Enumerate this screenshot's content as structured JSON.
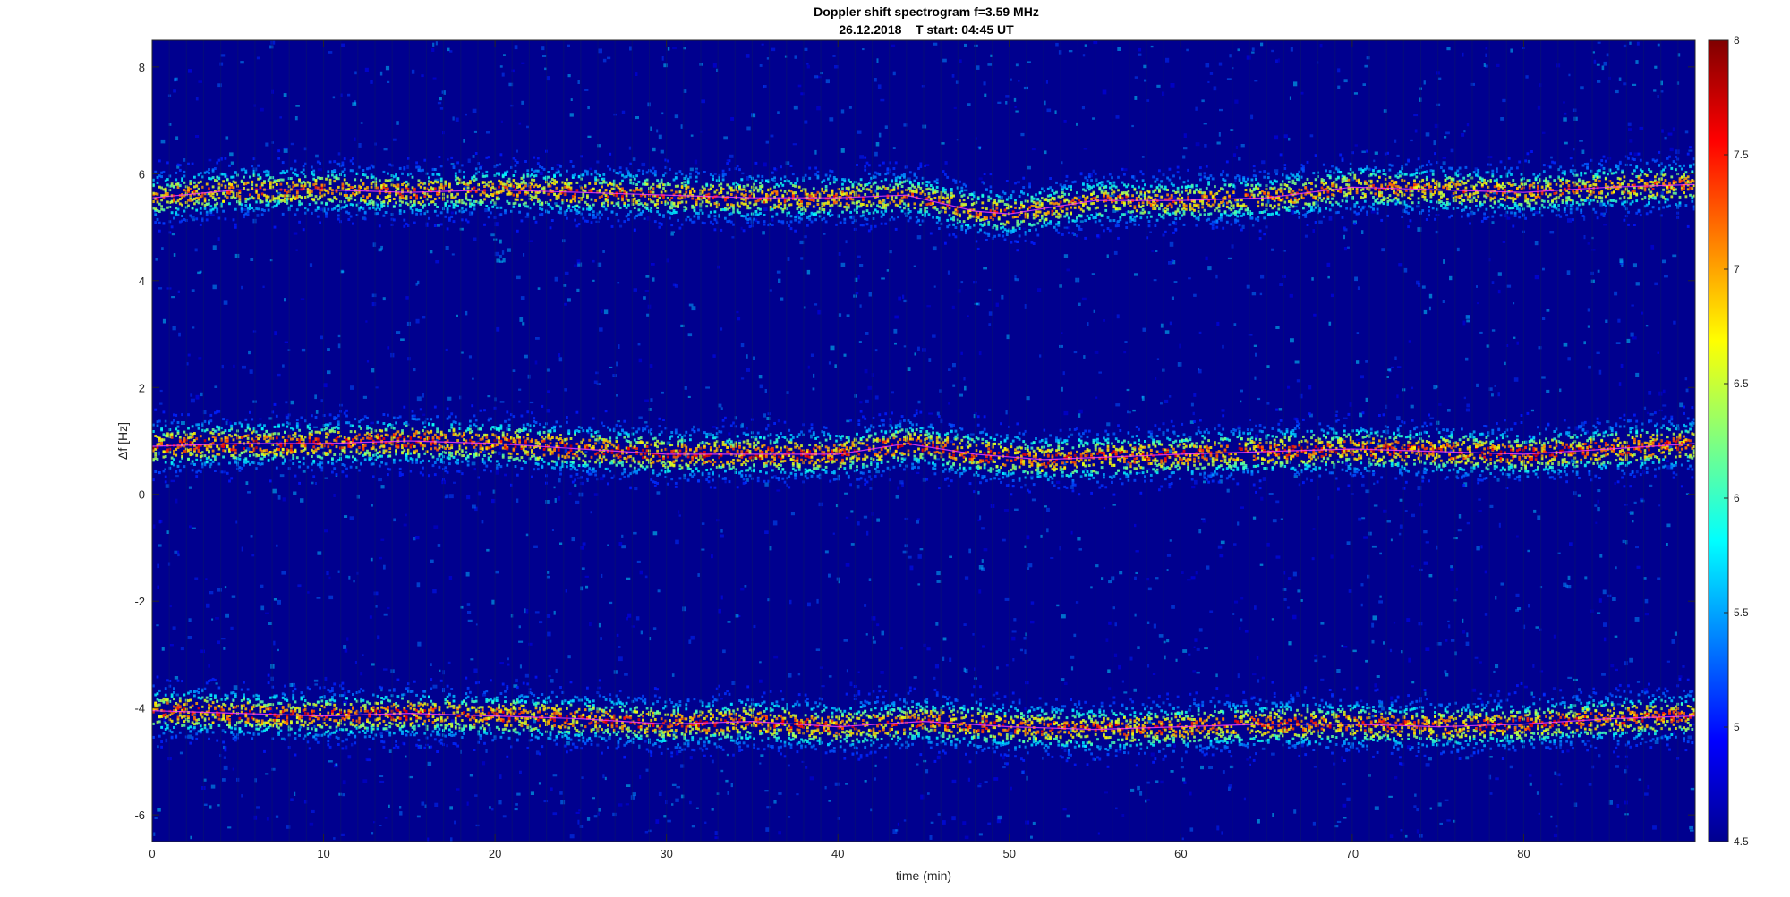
{
  "chart_data": {
    "type": "heatmap",
    "title": "Doppler shift spectrogram f=3.59 MHz",
    "subtitle": "26.12.2018    T start: 04:45 UT",
    "xlabel": "time (min)",
    "ylabel": "Δf [Hz]",
    "xlim": [
      0,
      90
    ],
    "ylim": [
      -6.5,
      8.5
    ],
    "x_ticks": [
      0,
      10,
      20,
      30,
      40,
      50,
      60,
      70,
      80
    ],
    "y_ticks": [
      -6,
      -4,
      -2,
      0,
      2,
      4,
      6,
      8
    ],
    "colormap": "jet",
    "clim": [
      4.5,
      8
    ],
    "colorbar_ticks": [
      4.5,
      5,
      5.5,
      6,
      6.5,
      7,
      7.5,
      8
    ],
    "colorbar_tick_labels": [
      "4.5",
      "5",
      "5.5",
      "6",
      "6.5",
      "7",
      "7.5",
      "8"
    ],
    "background_level": 4.8,
    "traces": [
      {
        "time": [
          0,
          5,
          10,
          15,
          20,
          25,
          30,
          35,
          40,
          44,
          48,
          50,
          55,
          60,
          65,
          70,
          75,
          80,
          85,
          90
        ],
        "doppler_hz": [
          5.55,
          5.7,
          5.7,
          5.65,
          5.7,
          5.65,
          5.6,
          5.55,
          5.55,
          5.6,
          5.3,
          5.25,
          5.5,
          5.5,
          5.55,
          5.75,
          5.7,
          5.65,
          5.75,
          5.8
        ],
        "peak_level": 7.6
      },
      {
        "time": [
          0,
          5,
          10,
          15,
          20,
          25,
          30,
          35,
          40,
          44,
          48,
          52,
          56,
          60,
          65,
          70,
          75,
          80,
          85,
          90
        ],
        "doppler_hz": [
          0.9,
          0.95,
          0.95,
          1.0,
          0.95,
          0.85,
          0.75,
          0.75,
          0.75,
          0.95,
          0.75,
          0.65,
          0.7,
          0.75,
          0.8,
          0.85,
          0.8,
          0.75,
          0.85,
          0.95
        ],
        "peak_level": 7.9
      },
      {
        "time": [
          0,
          5,
          10,
          15,
          20,
          25,
          30,
          35,
          40,
          45,
          50,
          55,
          60,
          65,
          70,
          75,
          80,
          85,
          90
        ],
        "doppler_hz": [
          -4.05,
          -4.1,
          -4.15,
          -4.1,
          -4.15,
          -4.2,
          -4.3,
          -4.25,
          -4.35,
          -4.25,
          -4.35,
          -4.4,
          -4.35,
          -4.3,
          -4.3,
          -4.35,
          -4.3,
          -4.2,
          -4.15
        ],
        "peak_level": 7.8
      }
    ]
  }
}
